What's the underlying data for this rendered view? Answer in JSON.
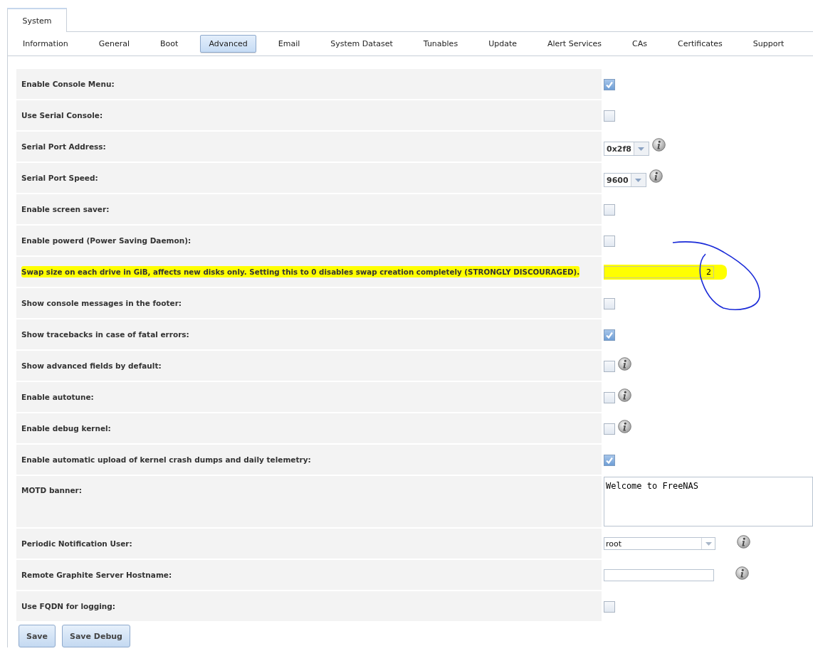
{
  "top_tabs": [
    {
      "label": "System",
      "selected": true
    }
  ],
  "sub_tabs": [
    {
      "label": "Information",
      "selected": false
    },
    {
      "label": "General",
      "selected": false
    },
    {
      "label": "Boot",
      "selected": false
    },
    {
      "label": "Advanced",
      "selected": true
    },
    {
      "label": "Email",
      "selected": false
    },
    {
      "label": "System Dataset",
      "selected": false
    },
    {
      "label": "Tunables",
      "selected": false
    },
    {
      "label": "Update",
      "selected": false
    },
    {
      "label": "Alert Services",
      "selected": false
    },
    {
      "label": "CAs",
      "selected": false
    },
    {
      "label": "Certificates",
      "selected": false
    },
    {
      "label": "Support",
      "selected": false
    }
  ],
  "settings": [
    {
      "label": "Enable Console Menu:",
      "kind": "checkbox",
      "checked": true,
      "info": false,
      "highlighted": false
    },
    {
      "label": "Use Serial Console:",
      "kind": "checkbox",
      "checked": false,
      "info": false,
      "highlighted": false
    },
    {
      "label": "Serial Port Address:",
      "kind": "select",
      "value": "0x2f8",
      "info": true,
      "highlighted": false
    },
    {
      "label": "Serial Port Speed:",
      "kind": "select",
      "value": "9600",
      "info": true,
      "highlighted": false
    },
    {
      "label": "Enable screen saver:",
      "kind": "checkbox",
      "checked": false,
      "info": false,
      "highlighted": false
    },
    {
      "label": "Enable powerd (Power Saving Daemon):",
      "kind": "checkbox",
      "checked": false,
      "info": false,
      "highlighted": false
    },
    {
      "label": "Swap size on each drive in GiB, affects new disks only. Setting this to 0 disables swap creation completely (STRONGLY DISCOURAGED).",
      "kind": "number",
      "value": "2",
      "info": false,
      "highlighted": true
    },
    {
      "label": "Show console messages in the footer:",
      "kind": "checkbox",
      "checked": false,
      "info": false,
      "highlighted": false
    },
    {
      "label": "Show tracebacks in case of fatal errors:",
      "kind": "checkbox",
      "checked": true,
      "info": false,
      "highlighted": false
    },
    {
      "label": "Show advanced fields by default:",
      "kind": "checkbox",
      "checked": false,
      "info": true,
      "highlighted": false
    },
    {
      "label": "Enable autotune:",
      "kind": "checkbox",
      "checked": false,
      "info": true,
      "highlighted": false
    },
    {
      "label": "Enable debug kernel:",
      "kind": "checkbox",
      "checked": false,
      "info": true,
      "highlighted": false
    },
    {
      "label": "Enable automatic upload of kernel crash dumps and daily telemetry:",
      "kind": "checkbox",
      "checked": true,
      "info": false,
      "highlighted": false
    },
    {
      "label": "MOTD banner:",
      "kind": "textarea",
      "value": "Welcome to FreeNAS",
      "info": false,
      "highlighted": false
    },
    {
      "label": "Periodic Notification User:",
      "kind": "wideselect",
      "value": "root",
      "info": true,
      "highlighted": false
    },
    {
      "label": "Remote Graphite Server Hostname:",
      "kind": "text",
      "info": true,
      "highlighted": false
    },
    {
      "label": "Use FQDN for logging:",
      "kind": "checkbox",
      "checked": false,
      "info": false,
      "highlighted": false
    }
  ],
  "buttons": [
    "Save",
    "Save Debug"
  ]
}
